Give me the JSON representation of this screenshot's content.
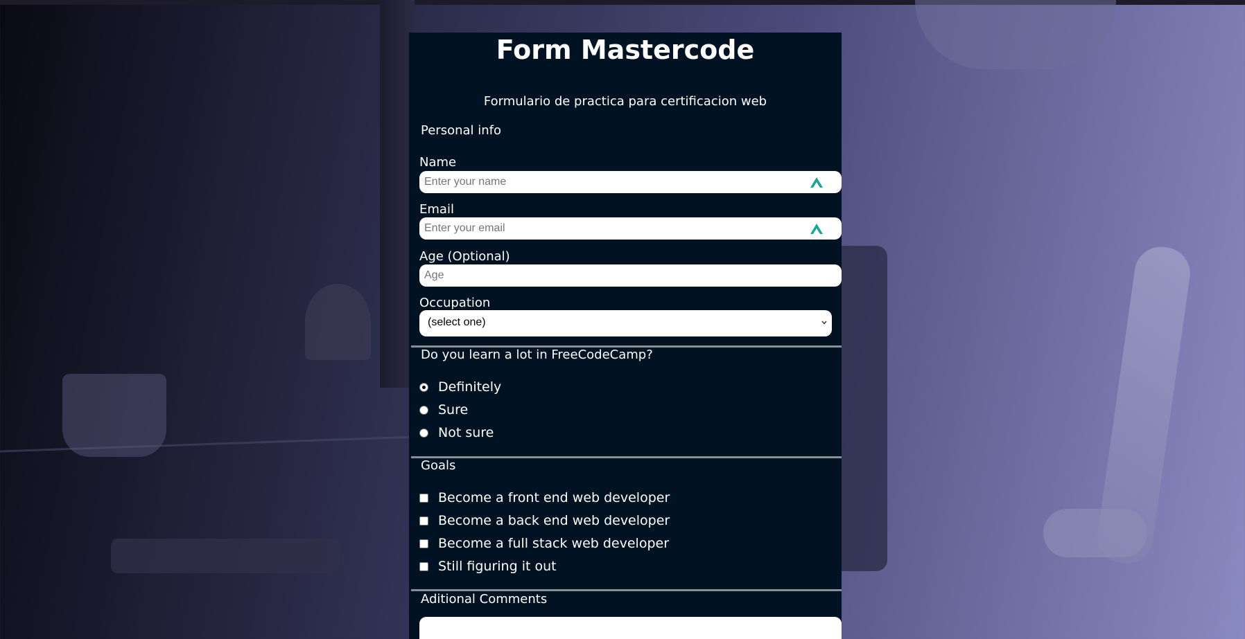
{
  "page": {
    "title": "Form Mastercode",
    "subtitle": "Formulario de practica para certificacion web"
  },
  "personal_info": {
    "heading": "Personal info",
    "name": {
      "label": "Name",
      "placeholder": "Enter your name",
      "icon": "password-manager-icon"
    },
    "email": {
      "label": "Email",
      "placeholder": "Enter your email",
      "icon": "password-manager-icon"
    },
    "age": {
      "label": "Age (Optional)",
      "placeholder": "Age"
    },
    "occupation": {
      "label": "Occupation",
      "selected": "(select one)"
    }
  },
  "learn_question": {
    "heading": "Do you learn a lot in FreeCodeCamp?",
    "options": [
      {
        "label": "Definitely",
        "checked": true
      },
      {
        "label": "Sure",
        "checked": false
      },
      {
        "label": "Not sure",
        "checked": false
      }
    ]
  },
  "goals": {
    "heading": "Goals",
    "options": [
      {
        "label": "Become a front end web developer",
        "checked": false
      },
      {
        "label": "Become a back end web developer",
        "checked": false
      },
      {
        "label": "Become a full stack web developer",
        "checked": false
      },
      {
        "label": "Still figuring it out",
        "checked": false
      }
    ]
  },
  "comments": {
    "heading": "Aditional Comments"
  },
  "colors": {
    "panel_bg": "#011222",
    "icon_accent": "#1aa39a"
  }
}
